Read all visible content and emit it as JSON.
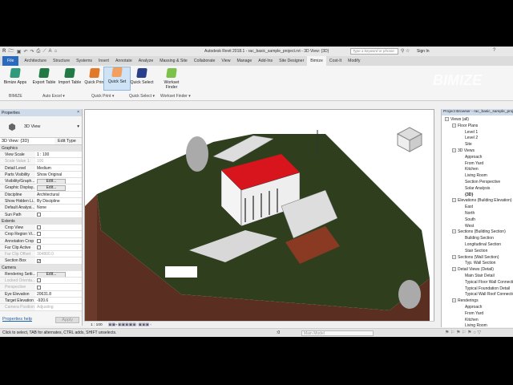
{
  "titlebar": {
    "title": "Autodesk Revit 2018.1 -   rac_basic_sample_project.rvt - 3D View: {3D}",
    "search_placeholder": "Type a keyword or phrase",
    "sign_in": "Sign In"
  },
  "tabs": [
    "File",
    "Architecture",
    "Structure",
    "Systems",
    "Insert",
    "Annotate",
    "Analyze",
    "Massing & Site",
    "Collaborate",
    "View",
    "Manage",
    "Add-Ins",
    "Site Designer",
    "Bimize",
    "Cost-It",
    "Modify"
  ],
  "ribbon": {
    "buttons": [
      {
        "label": "Bimize Apps",
        "color": "#2f9b7a"
      },
      {
        "label": "Export Table",
        "color": "#1f7a44"
      },
      {
        "label": "Import Table",
        "color": "#1f7a44"
      },
      {
        "label": "Quick Print",
        "color": "#e07a2a"
      },
      {
        "label": "Quick Set",
        "color": "#f0a060"
      },
      {
        "label": "Quick Select",
        "color": "#2a3f8a"
      },
      {
        "label": "Workset Finder",
        "color": "#7cc24a"
      }
    ],
    "panels": [
      "BIMIZE",
      "Auto Excel ▾",
      "Quick Print ▾",
      "Quick Select ▾",
      "Workset Finder ▾"
    ]
  },
  "properties": {
    "title": "Properties",
    "type_name": "3D View",
    "selector": "3D View: {3D}",
    "edit_type": "Edit Type",
    "groups": [
      {
        "name": "Graphics",
        "rows": [
          [
            "View Scale",
            "1 : 100"
          ],
          [
            "Scale Value    1:",
            "100"
          ],
          [
            "Detail Level",
            "Medium"
          ],
          [
            "Parts Visibility",
            "Show Original"
          ],
          [
            "Visibility/Graph...",
            "Edit..."
          ],
          [
            "Graphic Display...",
            "Edit..."
          ],
          [
            "Discipline",
            "Architectural"
          ],
          [
            "Show Hidden Li...",
            "By Discipline"
          ],
          [
            "Default Analysi...",
            "None"
          ],
          [
            "Sun Path",
            ""
          ]
        ]
      },
      {
        "name": "Extents",
        "rows": [
          [
            "Crop View",
            ""
          ],
          [
            "Crop Region Vi...",
            ""
          ],
          [
            "Annotation Crop",
            ""
          ],
          [
            "Far Clip Active",
            ""
          ],
          [
            "Far Clip Offset",
            "304800.0"
          ],
          [
            "Section Box",
            "✓"
          ]
        ]
      },
      {
        "name": "Camera",
        "rows": [
          [
            "Rendering Setti...",
            "Edit..."
          ],
          [
            "Locked Orienta...",
            ""
          ],
          [
            "Perspective",
            ""
          ],
          [
            "Eye Elevation",
            "20631.8"
          ],
          [
            "Target Elevation",
            "-920.6"
          ],
          [
            "Camera Position",
            "Adjusting"
          ]
        ]
      }
    ],
    "help": "Properties help",
    "apply": "Apply"
  },
  "browser": {
    "title": "Project Browser - rac_basic_sample_project.rvt",
    "items": [
      {
        "label": "Views (all)",
        "level": 0,
        "exp": "−"
      },
      {
        "label": "Floor Plans",
        "level": 1,
        "exp": "−"
      },
      {
        "label": "Level 1",
        "level": 2
      },
      {
        "label": "Level 2",
        "level": 2
      },
      {
        "label": "Site",
        "level": 2
      },
      {
        "label": "3D Views",
        "level": 1,
        "exp": "−"
      },
      {
        "label": "Approach",
        "level": 2
      },
      {
        "label": "From Yard",
        "level": 2
      },
      {
        "label": "Kitchen",
        "level": 2
      },
      {
        "label": "Living Room",
        "level": 2
      },
      {
        "label": "Section Perspective",
        "level": 2
      },
      {
        "label": "Solar Analysis",
        "level": 2
      },
      {
        "label": "{3D}",
        "level": 2,
        "bold": true
      },
      {
        "label": "Elevations (Building Elevation)",
        "level": 1,
        "exp": "−"
      },
      {
        "label": "East",
        "level": 2
      },
      {
        "label": "North",
        "level": 2
      },
      {
        "label": "South",
        "level": 2
      },
      {
        "label": "West",
        "level": 2
      },
      {
        "label": "Sections (Building Section)",
        "level": 1,
        "exp": "−"
      },
      {
        "label": "Building Section",
        "level": 2
      },
      {
        "label": "Longitudinal Section",
        "level": 2
      },
      {
        "label": "Stair Section",
        "level": 2
      },
      {
        "label": "Sections (Wall Section)",
        "level": 1,
        "exp": "−"
      },
      {
        "label": "Typ. Wall Section",
        "level": 2
      },
      {
        "label": "Detail Views (Detail)",
        "level": 1,
        "exp": "−"
      },
      {
        "label": "Main Stair Detail",
        "level": 2
      },
      {
        "label": "Typical Floor Wall Connection",
        "level": 2
      },
      {
        "label": "Typical Foundation Detail",
        "level": 2
      },
      {
        "label": "Typical Wall Roof Connection",
        "level": 2
      },
      {
        "label": "Renderings",
        "level": 1,
        "exp": "−"
      },
      {
        "label": "Approach",
        "level": 2
      },
      {
        "label": "From Yard",
        "level": 2
      },
      {
        "label": "Kitchen",
        "level": 2
      },
      {
        "label": "Living Room",
        "level": 2
      }
    ]
  },
  "viewbar": {
    "scale": "1 : 100"
  },
  "status": {
    "text": "Click to select, TAB for alternates, CTRL adds, SHIFT unselects.",
    "zero": ":0",
    "model": "Main Model"
  }
}
